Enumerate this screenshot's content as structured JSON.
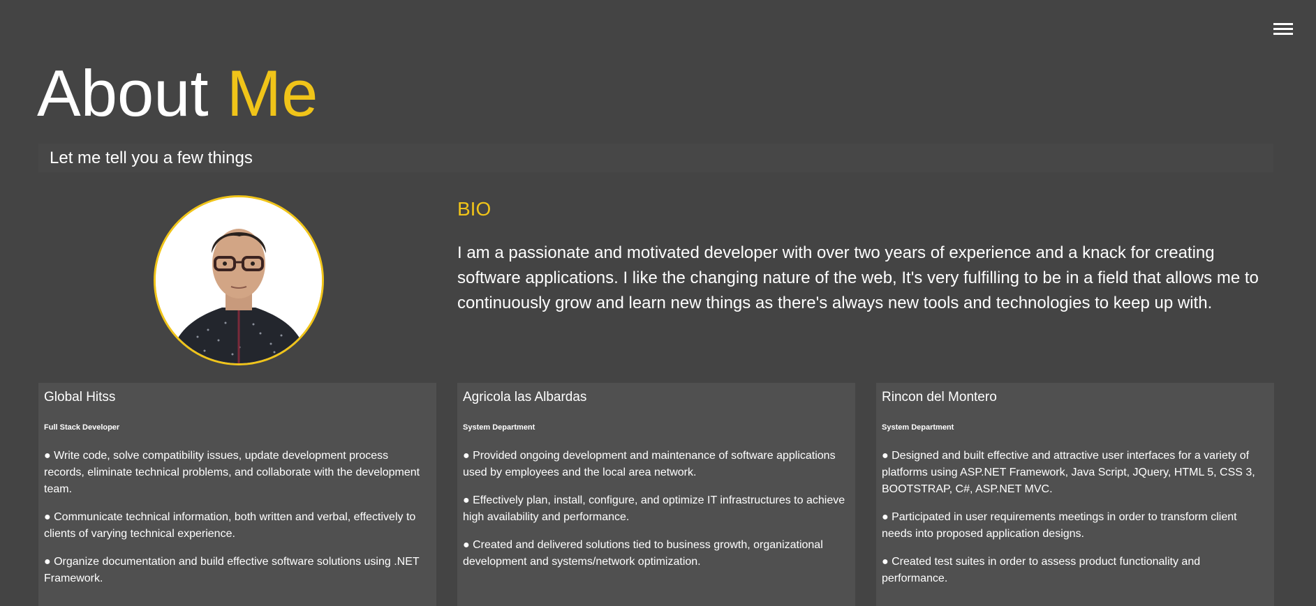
{
  "header": {
    "menu_icon": "hamburger-menu-icon",
    "title_part1": "About",
    "title_part2": "Me",
    "subtitle": "Let me tell you a few things",
    "accent_color": "#f0c419"
  },
  "profile": {
    "avatar_icon": "profile-photo"
  },
  "bio": {
    "heading": "BIO",
    "text": "I am a passionate and motivated developer with over two years of experience and a knack for creating software applications. I like the changing nature of the web, It's very fulfilling to be in a field that allows me to continuously grow and learn new things as there's always new tools and technologies to keep up with."
  },
  "jobs": [
    {
      "company": "Global Hitss",
      "role": "Full Stack Developer",
      "duties": [
        "● Write code, solve compatibility issues, update development process records, eliminate technical problems, and collaborate with the development team.",
        "● Communicate technical information, both written and verbal, effectively to clients of varying technical experience.",
        "● Organize documentation and build effective software solutions using .NET Framework."
      ]
    },
    {
      "company": "Agricola las Albardas",
      "role": "System Department",
      "duties": [
        "● Provided ongoing development and maintenance of software applications used by employees and the local area network.",
        "● Effectively plan, install, configure, and optimize IT infrastructures to achieve high availability and performance.",
        "● Created and delivered solutions tied to business growth, organizational development and systems/network optimization."
      ]
    },
    {
      "company": "Rincon del Montero",
      "role": "System Department",
      "duties": [
        "● Designed and built effective and attractive user interfaces for a variety of platforms using ASP.NET Framework, Java Script, JQuery, HTML 5, CSS 3, BOOTSTRAP, C#, ASP.NET MVC.",
        "● Participated in user requirements meetings in order to transform client needs into proposed application designs.",
        "● Created test suites in order to assess product functionality and performance."
      ]
    }
  ]
}
